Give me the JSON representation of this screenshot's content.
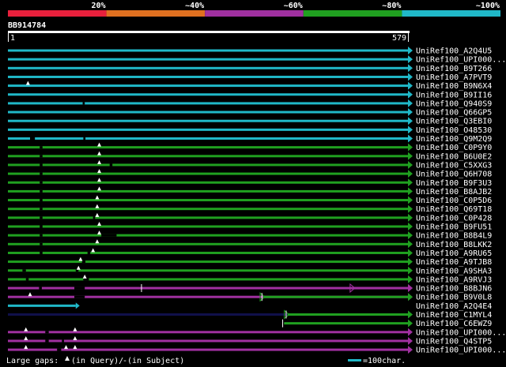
{
  "legend_scale": {
    "labels": [
      "20%",
      "~40%",
      "~60%",
      "~80%",
      "~100%"
    ],
    "colors": [
      "#e8203c",
      "#e07020",
      "#a030a0",
      "#20a020",
      "#20b8c8"
    ]
  },
  "query": {
    "id": "BB914784",
    "start_label": "1",
    "end_label": "579",
    "length": 579
  },
  "colors": {
    "cyan": "#20b8c8",
    "green": "#20a020",
    "purple": "#a030a0",
    "darkblue": "#10104a",
    "background": "#000000",
    "gap": "#000000"
  },
  "hits": [
    {
      "name": "UniRef100_A2Q4U5",
      "color": "cyan",
      "start": 1,
      "end": 579,
      "gaps": [],
      "marks": []
    },
    {
      "name": "UniRef100_UPI000...",
      "color": "cyan",
      "start": 1,
      "end": 579,
      "gaps": [],
      "marks": []
    },
    {
      "name": "UniRef100_B9T266",
      "color": "cyan",
      "start": 1,
      "end": 579,
      "gaps": [],
      "marks": []
    },
    {
      "name": "UniRef100_A7PVT9",
      "color": "cyan",
      "start": 1,
      "end": 579,
      "gaps": [],
      "marks": []
    },
    {
      "name": "UniRef100_B9N6X4",
      "color": "cyan",
      "start": 1,
      "end": 579,
      "gaps": [],
      "marks": [
        {
          "pos": 30,
          "t": "tri"
        }
      ]
    },
    {
      "name": "UniRef100_B9II16",
      "color": "cyan",
      "start": 1,
      "end": 579,
      "gaps": [],
      "marks": []
    },
    {
      "name": "UniRef100_Q940S9",
      "color": "cyan",
      "start": 1,
      "end": 579,
      "gaps": [
        [
          109,
          112
        ]
      ],
      "marks": []
    },
    {
      "name": "UniRef100_Q66GP5",
      "color": "cyan",
      "start": 1,
      "end": 579,
      "gaps": [],
      "marks": []
    },
    {
      "name": "UniRef100_Q3EBI0",
      "color": "cyan",
      "start": 1,
      "end": 579,
      "gaps": [],
      "marks": []
    },
    {
      "name": "UniRef100_O48530",
      "color": "cyan",
      "start": 1,
      "end": 579,
      "gaps": [],
      "marks": []
    },
    {
      "name": "UniRef100_Q9M2Q9",
      "color": "cyan",
      "start": 1,
      "end": 579,
      "gaps": [
        [
          33,
          40
        ],
        [
          110,
          113
        ]
      ],
      "marks": []
    },
    {
      "name": "UniRef100_C0P9Y0",
      "color": "green",
      "start": 1,
      "end": 579,
      "gaps": [
        [
          47,
          51
        ]
      ],
      "marks": [
        {
          "pos": 133,
          "t": "tri"
        }
      ]
    },
    {
      "name": "UniRef100_B6U0E2",
      "color": "green",
      "start": 1,
      "end": 579,
      "gaps": [
        [
          47,
          51
        ]
      ],
      "marks": [
        {
          "pos": 133,
          "t": "tri"
        }
      ]
    },
    {
      "name": "UniRef100_C5XXG3",
      "color": "green",
      "start": 1,
      "end": 579,
      "gaps": [
        [
          47,
          51
        ],
        [
          148,
          152
        ]
      ],
      "marks": [
        {
          "pos": 133,
          "t": "tri"
        }
      ]
    },
    {
      "name": "UniRef100_Q6H708",
      "color": "green",
      "start": 1,
      "end": 579,
      "gaps": [
        [
          47,
          51
        ]
      ],
      "marks": [
        {
          "pos": 133,
          "t": "tri"
        }
      ]
    },
    {
      "name": "UniRef100_B9F3U3",
      "color": "green",
      "start": 1,
      "end": 579,
      "gaps": [
        [
          47,
          51
        ]
      ],
      "marks": [
        {
          "pos": 133,
          "t": "tri"
        }
      ]
    },
    {
      "name": "UniRef100_B8AJB2",
      "color": "green",
      "start": 1,
      "end": 579,
      "gaps": [
        [
          47,
          51
        ]
      ],
      "marks": [
        {
          "pos": 133,
          "t": "tri"
        }
      ]
    },
    {
      "name": "UniRef100_C0P5D6",
      "color": "green",
      "start": 1,
      "end": 579,
      "gaps": [
        [
          47,
          51
        ]
      ],
      "marks": [
        {
          "pos": 130,
          "t": "tri"
        }
      ]
    },
    {
      "name": "UniRef100_Q69T18",
      "color": "green",
      "start": 1,
      "end": 579,
      "gaps": [
        [
          47,
          51
        ]
      ],
      "marks": [
        {
          "pos": 130,
          "t": "tri"
        }
      ]
    },
    {
      "name": "UniRef100_C0P428",
      "color": "green",
      "start": 1,
      "end": 579,
      "gaps": [
        [
          47,
          51
        ],
        [
          124,
          127
        ]
      ],
      "marks": [
        {
          "pos": 130,
          "t": "tri"
        }
      ]
    },
    {
      "name": "UniRef100_B9FU51",
      "color": "green",
      "start": 1,
      "end": 579,
      "gaps": [
        [
          47,
          51
        ]
      ],
      "marks": [
        {
          "pos": 133,
          "t": "tri"
        }
      ]
    },
    {
      "name": "UniRef100_B8B4L9",
      "color": "green",
      "start": 1,
      "end": 579,
      "gaps": [
        [
          47,
          51
        ],
        [
          136,
          158
        ]
      ],
      "marks": [
        {
          "pos": 133,
          "t": "tri"
        }
      ]
    },
    {
      "name": "UniRef100_B8LKK2",
      "color": "green",
      "start": 1,
      "end": 579,
      "gaps": [
        [
          47,
          51
        ]
      ],
      "marks": [
        {
          "pos": 130,
          "t": "tri"
        }
      ]
    },
    {
      "name": "UniRef100_A9RU65",
      "color": "green",
      "start": 1,
      "end": 579,
      "gaps": [
        [
          47,
          51
        ],
        [
          116,
          120
        ]
      ],
      "marks": [
        {
          "pos": 124,
          "t": "tri"
        }
      ]
    },
    {
      "name": "UniRef100_A9TJB8",
      "color": "green",
      "start": 1,
      "end": 579,
      "gaps": [
        [
          108,
          113
        ]
      ],
      "marks": [
        {
          "pos": 106,
          "t": "tri"
        }
      ]
    },
    {
      "name": "UniRef100_A9SHA3",
      "color": "green",
      "start": 1,
      "end": 579,
      "gaps": [
        [
          22,
          27
        ],
        [
          99,
          103
        ]
      ],
      "marks": [
        {
          "pos": 103,
          "t": "tri"
        }
      ]
    },
    {
      "name": "UniRef100_A9RVJ3",
      "color": "green",
      "start": 1,
      "end": 579,
      "gaps": [
        [
          27,
          31
        ],
        [
          110,
          118
        ]
      ],
      "marks": [
        {
          "pos": 112,
          "t": "tri"
        }
      ]
    },
    {
      "name": "UniRef100_B8BJN6",
      "color": "purple",
      "start": 1,
      "end": 579,
      "gaps": [
        [
          46,
          50
        ],
        [
          97,
          112
        ]
      ],
      "marks": [
        {
          "pos": 194,
          "t": "tick"
        }
      ],
      "extra": {
        "color": "purple",
        "start": 500,
        "end": 579
      }
    },
    {
      "name": "UniRef100_B9V0L8",
      "color": "purple",
      "start": 1,
      "end": 579,
      "gaps": [
        [
          97,
          112
        ]
      ],
      "marks": [
        {
          "pos": 33,
          "t": "tri"
        },
        {
          "pos": 368,
          "t": "tick"
        }
      ],
      "extra": {
        "color": "green",
        "start": 370,
        "end": 579
      }
    },
    {
      "name": "UniRef100_A2Q4E4",
      "color": "cyan",
      "start": 1,
      "end": 99,
      "gaps": [],
      "marks": []
    },
    {
      "name": "UniRef100_C1MYL4",
      "color": "darkblue",
      "start": 1,
      "end": 579,
      "gaps": [],
      "marks": [
        {
          "pos": 403,
          "t": "tick"
        }
      ],
      "extra": {
        "color": "green",
        "start": 405,
        "end": 579
      }
    },
    {
      "name": "UniRef100_C6EWZ9",
      "color": "green",
      "start": 400,
      "end": 579,
      "gaps": [],
      "marks": [
        {
          "pos": 398,
          "t": "tick"
        }
      ]
    },
    {
      "name": "UniRef100_UPI000...",
      "color": "purple",
      "start": 1,
      "end": 579,
      "gaps": [
        [
          55,
          60
        ]
      ],
      "marks": [
        {
          "pos": 27,
          "t": "tri"
        },
        {
          "pos": 98,
          "t": "tri"
        }
      ]
    },
    {
      "name": "UniRef100_Q4STP5",
      "color": "purple",
      "start": 1,
      "end": 579,
      "gaps": [
        [
          55,
          60
        ],
        [
          79,
          82
        ]
      ],
      "marks": [
        {
          "pos": 27,
          "t": "tri"
        },
        {
          "pos": 98,
          "t": "tri"
        }
      ]
    },
    {
      "name": "UniRef100_UPI000...",
      "color": "purple",
      "start": 1,
      "end": 579,
      "gaps": [
        [
          72,
          78
        ]
      ],
      "marks": [
        {
          "pos": 27,
          "t": "tri"
        },
        {
          "pos": 85,
          "t": "tri"
        },
        {
          "pos": 98,
          "t": "tri"
        }
      ]
    }
  ],
  "footer": {
    "gaps_prefix": "Large gaps: ",
    "gaps_query": "(in Query)/",
    "gaps_subject": "-(in Subject)",
    "scale_text": "=100char."
  }
}
